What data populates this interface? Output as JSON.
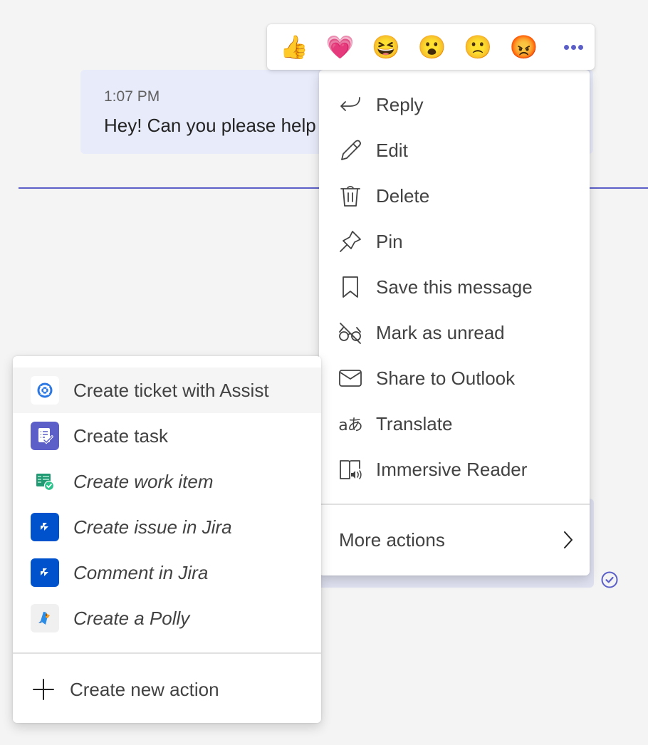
{
  "message": {
    "time": "1:07 PM",
    "text": "Hey! Can you please help me with this?"
  },
  "colors": {
    "accent": "#5b5fc7",
    "bubble": "#e8ebfa",
    "background": "#f4f4f4"
  },
  "reactions": [
    {
      "name": "like",
      "glyph": "👍"
    },
    {
      "name": "heart",
      "glyph": "💗"
    },
    {
      "name": "laugh",
      "glyph": "😆"
    },
    {
      "name": "surprised",
      "glyph": "😮"
    },
    {
      "name": "sad",
      "glyph": "🙁"
    },
    {
      "name": "angry",
      "glyph": "😡"
    }
  ],
  "reaction_more_icon": "more-options-icon",
  "context_menu": {
    "items": [
      {
        "label": "Reply",
        "icon": "reply-icon"
      },
      {
        "label": "Edit",
        "icon": "edit-icon"
      },
      {
        "label": "Delete",
        "icon": "delete-icon"
      },
      {
        "label": "Pin",
        "icon": "pin-icon"
      },
      {
        "label": "Save this message",
        "icon": "bookmark-icon"
      },
      {
        "label": "Mark as unread",
        "icon": "mark-unread-icon"
      },
      {
        "label": "Share to Outlook",
        "icon": "mail-icon"
      },
      {
        "label": "Translate",
        "icon": "translate-icon"
      },
      {
        "label": "Immersive Reader",
        "icon": "immersive-reader-icon"
      }
    ],
    "more_actions": {
      "label": "More actions",
      "icon": "chevron-right-icon"
    }
  },
  "more_actions_menu": {
    "items": [
      {
        "label": "Create ticket with Assist",
        "app": "assist",
        "italic": false,
        "hovered": true
      },
      {
        "label": "Create task",
        "app": "tasks",
        "italic": false,
        "hovered": false
      },
      {
        "label": "Create work item",
        "app": "azure-boards",
        "italic": true,
        "hovered": false
      },
      {
        "label": "Create issue in Jira",
        "app": "jira",
        "italic": true,
        "hovered": false
      },
      {
        "label": "Comment in Jira",
        "app": "jira",
        "italic": true,
        "hovered": false
      },
      {
        "label": "Create a Polly",
        "app": "polly",
        "italic": true,
        "hovered": false
      }
    ],
    "create_new": {
      "label": "Create new action",
      "icon": "plus-icon"
    }
  }
}
